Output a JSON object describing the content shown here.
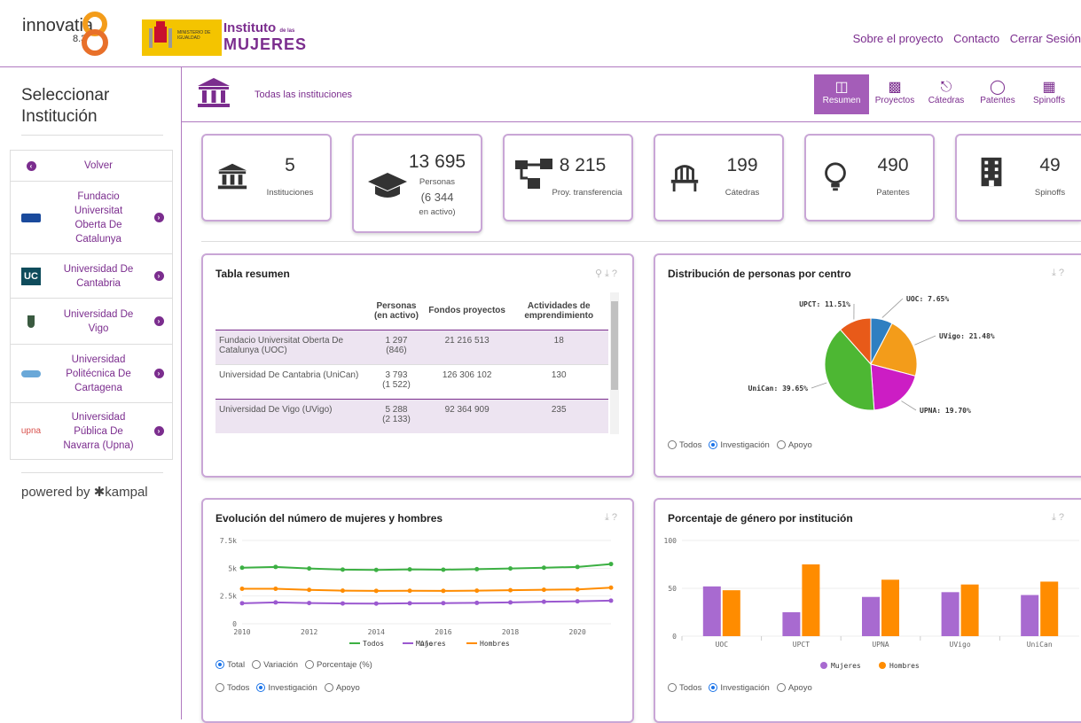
{
  "header": {
    "logo_text": "innovatia",
    "logo_sub": "8.3",
    "ministry_text": "MINISTERIO DE IGUALDAD",
    "instituto_line1": "Instituto",
    "instituto_de": "de las",
    "instituto_line2": "MUJERES",
    "nav": [
      "Sobre el proyecto",
      "Contacto",
      "Cerrar Sesión"
    ]
  },
  "sidebar": {
    "title": "Seleccionar Institución",
    "back_label": "Volver",
    "items": [
      {
        "label": "Fundacio Universitat Oberta De Catalunya",
        "logo": "UOC"
      },
      {
        "label": "Universidad De Cantabria",
        "logo": "UC"
      },
      {
        "label": "Universidad De Vigo",
        "logo": "uvigo-shield"
      },
      {
        "label": "Universidad Politécnica De Cartagena",
        "logo": "upct-globe"
      },
      {
        "label": "Universidad Pública De Navarra (Upna)",
        "logo": "upna"
      }
    ],
    "powered": "powered by ✱kampal"
  },
  "breadcrumb": {
    "text": "Todas las instituciones"
  },
  "tabs": [
    {
      "label": "Resumen",
      "icon": "summary-icon",
      "active": true
    },
    {
      "label": "Proyectos",
      "icon": "projects-icon",
      "active": false
    },
    {
      "label": "Cátedras",
      "icon": "chair-icon",
      "active": false
    },
    {
      "label": "Patentes",
      "icon": "bulb-icon",
      "active": false
    },
    {
      "label": "Spinoffs",
      "icon": "building-icon",
      "active": false
    }
  ],
  "kpis": [
    {
      "value": "5",
      "label": "Instituciones",
      "icon": "institution-icon"
    },
    {
      "value": "13 695",
      "label": "Personas",
      "extra": "(6 344",
      "extra2": "en activo)",
      "icon": "graduation-cap-icon"
    },
    {
      "value": "8 215",
      "label": "Proy. transferencia",
      "icon": "projects-icon"
    },
    {
      "value": "199",
      "label": "Cátedras",
      "icon": "chair-icon"
    },
    {
      "value": "490",
      "label": "Patentes",
      "icon": "bulb-icon"
    },
    {
      "value": "49",
      "label": "Spinoffs",
      "icon": "building-icon"
    }
  ],
  "summary_table": {
    "title": "Tabla resumen",
    "headers": [
      "",
      "Personas (en activo)",
      "Fondos proyectos",
      "Actividades de emprendimiento"
    ],
    "rows": [
      {
        "name": "Fundacio Universitat Oberta De Catalunya (UOC)",
        "personas": "1 297",
        "activos": "(846)",
        "fondos": "21 216 513",
        "actividades": "18"
      },
      {
        "name": "Universidad De Cantabria (UniCan)",
        "personas": "3 793",
        "activos": "(1 522)",
        "fondos": "126 306 102",
        "actividades": "130"
      },
      {
        "name": "Universidad De Vigo (UVigo)",
        "personas": "5 288",
        "activos": "(2 133)",
        "fondos": "92 364 909",
        "actividades": "235"
      }
    ]
  },
  "radio_labels": {
    "todos": "Todos",
    "investigacion": "Investigación",
    "apoyo": "Apoyo",
    "total": "Total",
    "variacion": "Variación",
    "porcentaje": "Porcentaje (%)"
  },
  "chart_data": [
    {
      "type": "pie",
      "title": "Distribución de personas por centro",
      "slices": [
        {
          "label": "UOC",
          "value": 7.65,
          "display": "UOC: 7.65%",
          "color": "#2f7fc1"
        },
        {
          "label": "UVigo",
          "value": 21.48,
          "display": "UVigo: 21.48%",
          "color": "#f39c1a"
        },
        {
          "label": "UPNA",
          "value": 19.7,
          "display": "UPNA: 19.70%",
          "color": "#cc1dc4"
        },
        {
          "label": "UniCan",
          "value": 39.65,
          "display": "UniCan: 39.65%",
          "color": "#4db733"
        },
        {
          "label": "UPCT",
          "value": 11.51,
          "display": "UPCT: 11.51%",
          "color": "#e85a19"
        }
      ]
    },
    {
      "type": "line",
      "title": "Evolución del número de mujeres y hombres",
      "xlabel": "Año",
      "ylabel": "",
      "x": [
        2010,
        2011,
        2012,
        2013,
        2014,
        2015,
        2016,
        2017,
        2018,
        2019,
        2020,
        2021
      ],
      "xticks": [
        "2010",
        "2012",
        "2014",
        "2016",
        "2018",
        "2020"
      ],
      "yticks": [
        "0",
        "2.5k",
        "5k",
        "7.5k"
      ],
      "ylim": [
        0,
        7500
      ],
      "series": [
        {
          "name": "Todos",
          "color": "#3cb043",
          "values": [
            5050,
            5120,
            4980,
            4880,
            4850,
            4900,
            4870,
            4920,
            4980,
            5050,
            5120,
            5380
          ]
        },
        {
          "name": "Mujeres",
          "color": "#9b59d0",
          "values": [
            1850,
            1920,
            1870,
            1830,
            1820,
            1850,
            1860,
            1880,
            1920,
            1980,
            2020,
            2080
          ]
        },
        {
          "name": "Hombres",
          "color": "#ff8c00",
          "values": [
            3150,
            3150,
            3050,
            2980,
            2960,
            2970,
            2960,
            2980,
            3020,
            3060,
            3090,
            3250
          ]
        }
      ]
    },
    {
      "type": "bar",
      "title": "Porcentaje de género por institución",
      "categories": [
        "UOC",
        "UPCT",
        "UPNA",
        "UVigo",
        "UniCan"
      ],
      "ylim": [
        0,
        100
      ],
      "yticks": [
        "0",
        "50",
        "100"
      ],
      "series": [
        {
          "name": "Mujeres",
          "color": "#a86ad0",
          "values": [
            52,
            25,
            41,
            46,
            43
          ]
        },
        {
          "name": "Hombres",
          "color": "#ff8c00",
          "values": [
            48,
            75,
            59,
            54,
            57
          ]
        }
      ]
    }
  ]
}
